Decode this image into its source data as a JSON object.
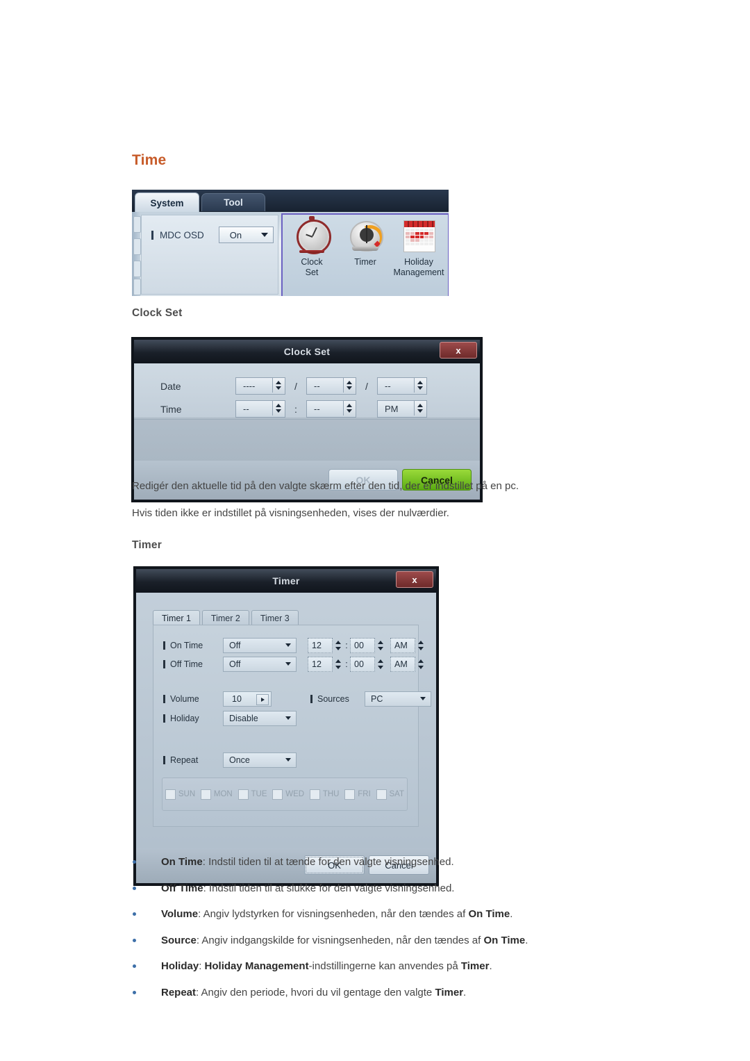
{
  "page": {
    "section_heading": "Time",
    "accent_color": "#c75b29",
    "bullet_color": "#3d6fa8"
  },
  "system_panel": {
    "tabs": [
      {
        "label": "System",
        "active": true
      },
      {
        "label": "Tool",
        "active": false
      }
    ],
    "setting": {
      "label": "MDC OSD",
      "value": "On"
    },
    "icons": [
      {
        "name": "clock-set-icon",
        "caption_line1": "Clock",
        "caption_line2": "Set"
      },
      {
        "name": "timer-icon",
        "caption_line1": "Timer",
        "caption_line2": ""
      },
      {
        "name": "holiday-management-icon",
        "caption_line1": "Holiday",
        "caption_line2": "Management"
      }
    ]
  },
  "clock_set": {
    "heading": "Clock Set",
    "dialog_title": "Clock Set",
    "close_label": "x",
    "rows": [
      {
        "label": "Date",
        "fields": [
          {
            "value": "----"
          },
          {
            "value": "--"
          },
          {
            "value": "--"
          }
        ],
        "separators": [
          "/",
          "/"
        ]
      },
      {
        "label": "Time",
        "fields": [
          {
            "value": "--"
          },
          {
            "value": "--"
          },
          {
            "value": "PM"
          }
        ],
        "separators": [
          ":",
          ""
        ]
      }
    ],
    "ok_label": "OK",
    "cancel_label": "Cancel",
    "paragraphs": [
      "Redigér den aktuelle tid på den valgte skærm efter den tid, der er indstillet på en pc.",
      "Hvis tiden ikke er indstillet på visningsenheden, vises der nulværdier."
    ]
  },
  "timer": {
    "heading": "Timer",
    "dialog_title": "Timer",
    "close_label": "x",
    "tabs": [
      {
        "label": "Timer 1",
        "active": true
      },
      {
        "label": "Timer 2",
        "active": false
      },
      {
        "label": "Timer 3",
        "active": false
      }
    ],
    "on_time": {
      "label": "On Time",
      "state": "Off",
      "hour": "12",
      "minute": "00",
      "meridiem": "AM",
      "colon": ":"
    },
    "off_time": {
      "label": "Off Time",
      "state": "Off",
      "hour": "12",
      "minute": "00",
      "meridiem": "AM",
      "colon": ":"
    },
    "volume": {
      "label": "Volume",
      "value": "10"
    },
    "sources": {
      "label": "Sources",
      "value": "PC"
    },
    "holiday": {
      "label": "Holiday",
      "value": "Disable"
    },
    "repeat": {
      "label": "Repeat",
      "value": "Once"
    },
    "days": [
      {
        "label": "SUN",
        "checked": false
      },
      {
        "label": "MON",
        "checked": false
      },
      {
        "label": "TUE",
        "checked": false
      },
      {
        "label": "WED",
        "checked": false
      },
      {
        "label": "THU",
        "checked": false
      },
      {
        "label": "FRI",
        "checked": false
      },
      {
        "label": "SAT",
        "checked": false
      }
    ],
    "ok_label": "OK",
    "cancel_label": "Cancel"
  },
  "bullets": [
    {
      "term": "On Time",
      "rest": ": Indstil tiden til at tænde for den valgte visningsenhed."
    },
    {
      "term": "Off Time",
      "rest": ": Indstil tiden til at slukke for den valgte visningsenhed."
    },
    {
      "term": "Volume",
      "rest": ": Angiv lydstyrken for visningsenheden, når den tændes af ",
      "term2": "On Time",
      "tail": "."
    },
    {
      "term": "Source",
      "rest": ": Angiv indgangskilde for visningsenheden, når den tændes af ",
      "term2": "On Time",
      "tail": "."
    },
    {
      "term": "Holiday",
      "rest": ": ",
      "term2": "Holiday Management",
      "rest2": "-indstillingerne kan anvendes på ",
      "term3": "Timer",
      "tail": "."
    },
    {
      "term": "Repeat",
      "rest": ": Angiv den periode, hvori du vil gentage den valgte ",
      "term2": "Timer",
      "tail": "."
    }
  ]
}
